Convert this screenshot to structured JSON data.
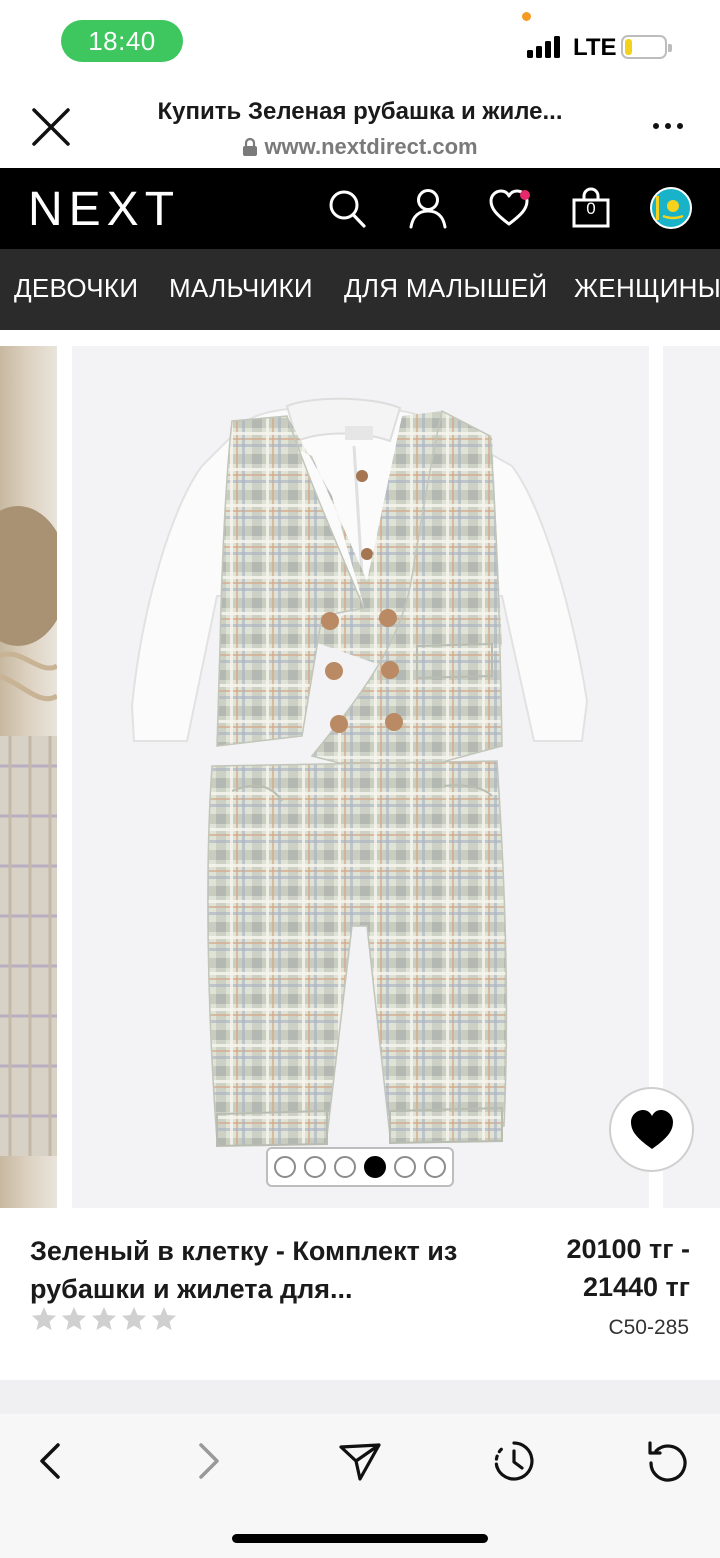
{
  "status_bar": {
    "time": "18:40",
    "network": "LTE",
    "battery_level": 0.18
  },
  "browser": {
    "title": "Купить Зеленая рубашка и жиле...",
    "url": "www.nextdirect.com"
  },
  "site_header": {
    "logo": "NEXT",
    "bag_count": "0",
    "icons": [
      "search-icon",
      "account-icon",
      "favourites-icon",
      "bag-icon",
      "kazakhstan-flag-icon"
    ]
  },
  "categories": [
    "ДЕВОЧКИ",
    "МАЛЬЧИКИ",
    "ДЛЯ МАЛЫШЕЙ",
    "ЖЕНЩИНЫ"
  ],
  "carousel": {
    "total_slides": 6,
    "active_slide": 4
  },
  "product": {
    "name": "Зеленый в клетку - Комплект из рубашки и жилета для...",
    "price_from": "20100 тг -",
    "price_to": "21440 тг",
    "sku": "C50-285",
    "rating": 0,
    "rating_max": 5
  },
  "toolbar": {
    "icons": [
      "back-icon",
      "forward-icon",
      "share-icon",
      "history-icon",
      "reload-icon"
    ]
  },
  "colors": {
    "header_bg": "#000000",
    "nav_bg": "#2b2b2b",
    "time_pill": "#3ec75e",
    "favourite_dot": "#e5296b"
  }
}
